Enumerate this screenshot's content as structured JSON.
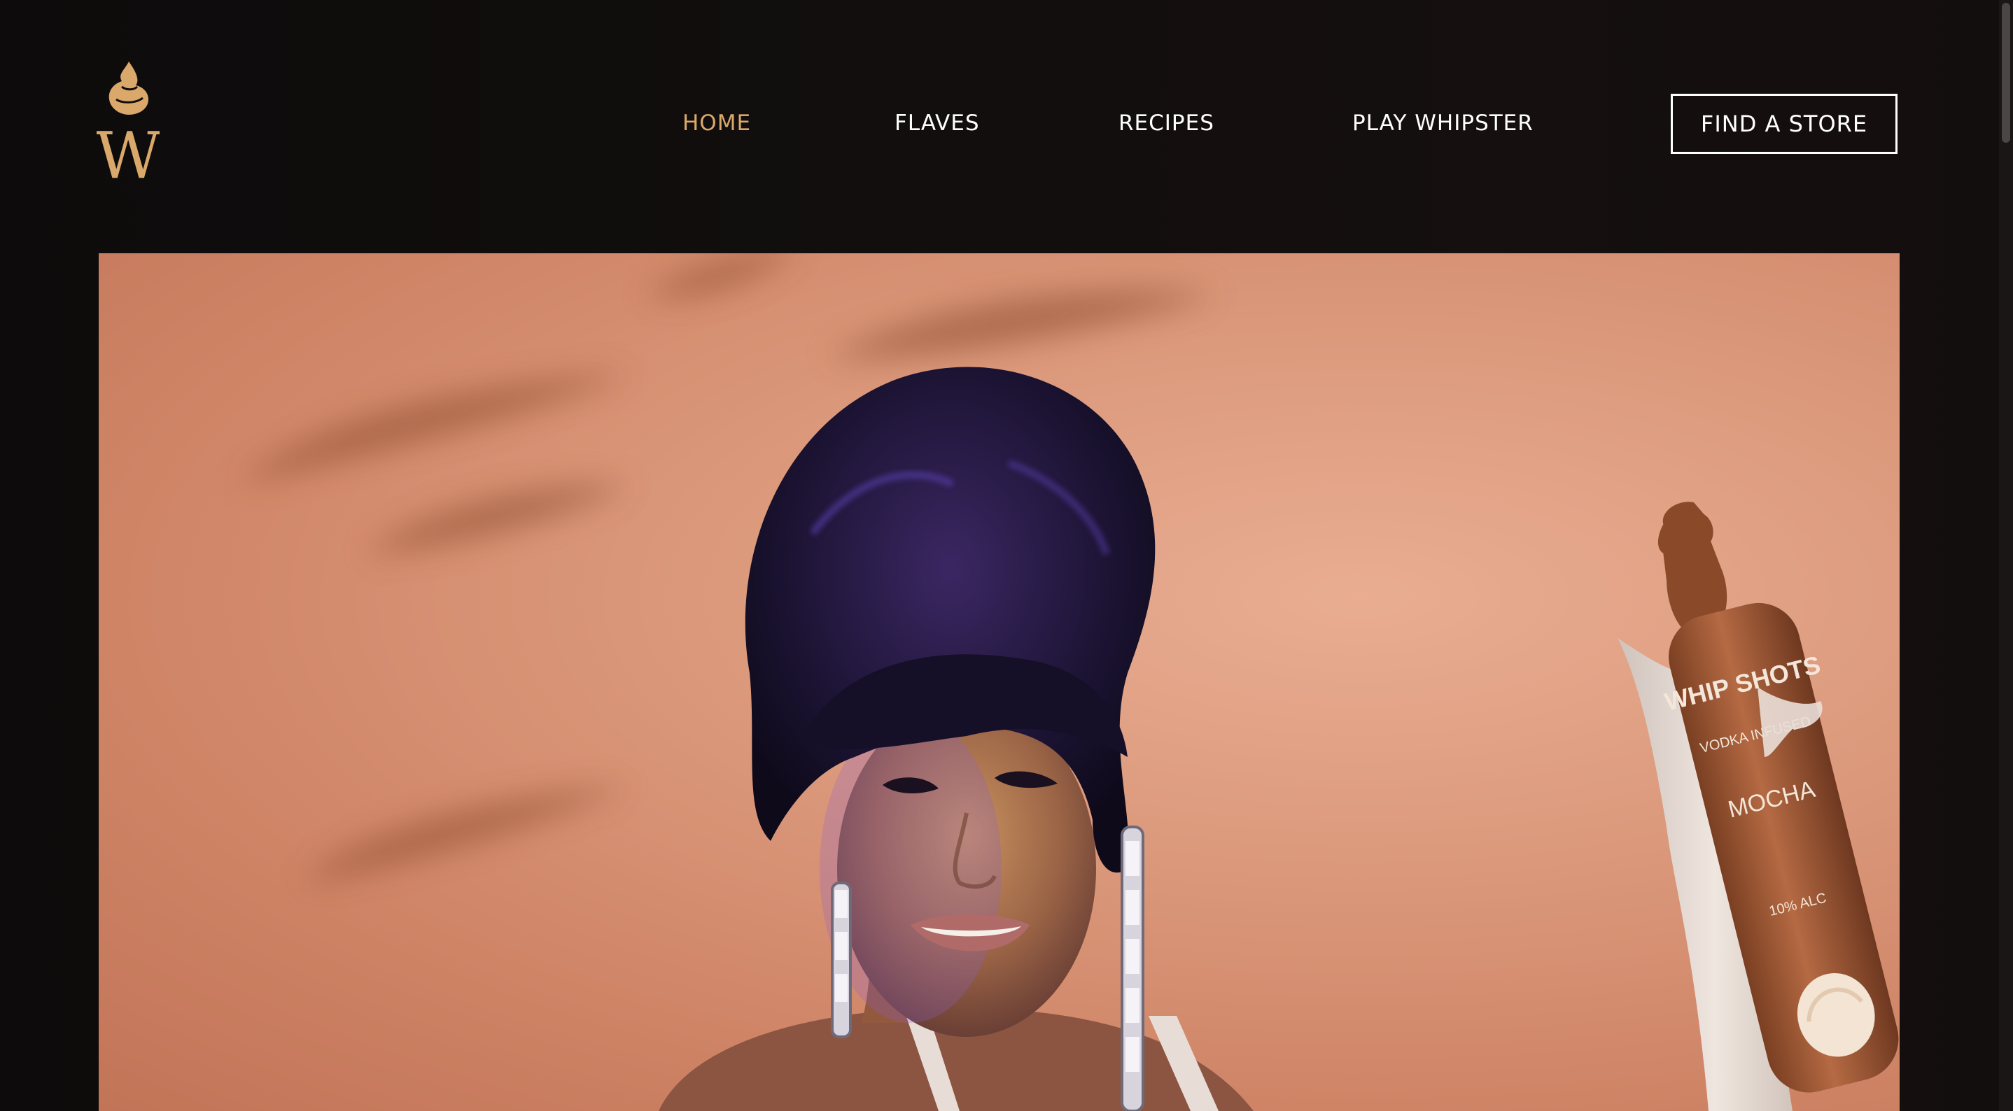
{
  "nav": {
    "items": [
      {
        "label": "HOME",
        "active": true
      },
      {
        "label": "FLAVES",
        "active": false
      },
      {
        "label": "RECIPES",
        "active": false
      },
      {
        "label": "PLAY WHIPSTER",
        "active": false
      }
    ],
    "cta_label": "FIND A STORE"
  },
  "logo": {
    "letter": "W",
    "icon": "whipped-cream-logo-icon"
  },
  "hero": {
    "image": "hero-photo",
    "product": {
      "brand_text": "WHIP SHOTS",
      "type_text": "VODKA INFUSED",
      "flavor_text": "MOCHA",
      "abv_text": "10% ALC"
    }
  },
  "colors": {
    "accent": "#d9a86a",
    "background": "#110d0d",
    "text": "#ffffff",
    "hero_wall": "#dc9a7d"
  }
}
